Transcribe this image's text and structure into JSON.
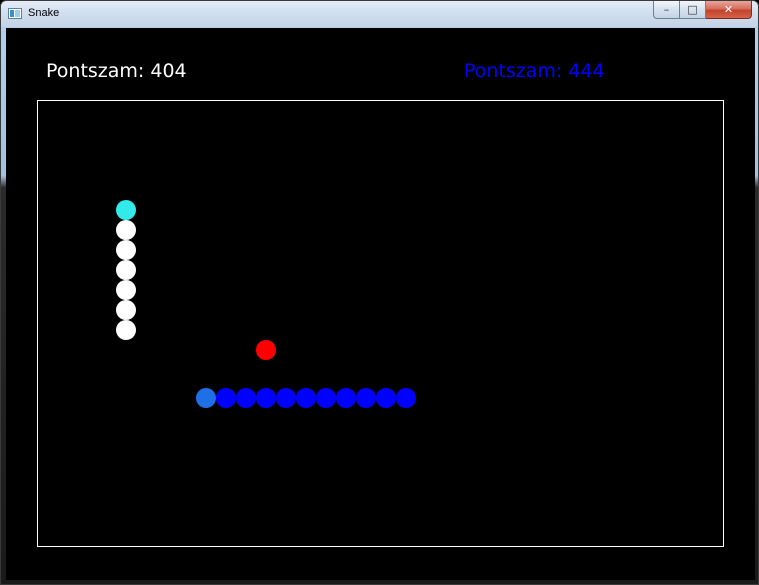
{
  "window": {
    "title": "Snake",
    "controls": {
      "minimize": "–",
      "maximize": "□",
      "close": "✕"
    }
  },
  "scores": {
    "player1": {
      "text": "Pontszam: 404",
      "color": "#ffffff"
    },
    "player2": {
      "text": "Pontszam: 444",
      "color": "#0000ff"
    }
  },
  "colors": {
    "snake1_head": "#33eaea",
    "snake1_body": "#ffffff",
    "snake2_head": "#1f6fe8",
    "snake2_body": "#0000ff",
    "food": "#ff0000",
    "arena_border": "#ffffff",
    "background": "#000000"
  }
}
